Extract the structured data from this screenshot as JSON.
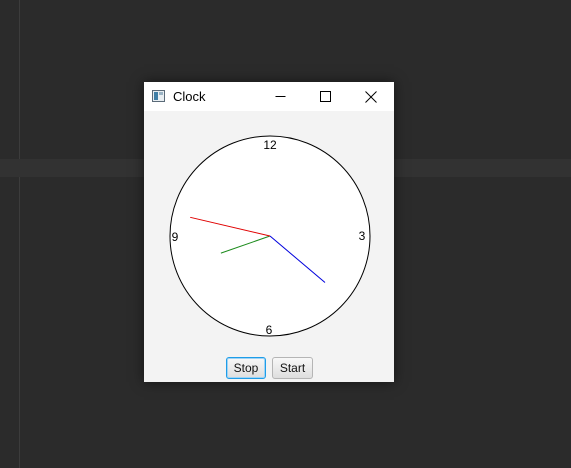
{
  "window": {
    "title": "Clock",
    "icon": "java-app-icon",
    "controls": [
      "minimize-icon",
      "maximize-icon",
      "close-icon"
    ]
  },
  "clock": {
    "numerals": {
      "twelve": "12",
      "three": "3",
      "six": "6",
      "nine": "9"
    },
    "time": {
      "hour": 8,
      "minute": 21.7,
      "second": 47.2
    },
    "colors": {
      "face": "#ffffff",
      "rim": "#000000",
      "hour_hand": "#1a8a1a",
      "minute_hand": "#0000dd",
      "second_hand": "#e00000"
    }
  },
  "buttons": {
    "stop_label": "Stop",
    "start_label": "Start"
  }
}
